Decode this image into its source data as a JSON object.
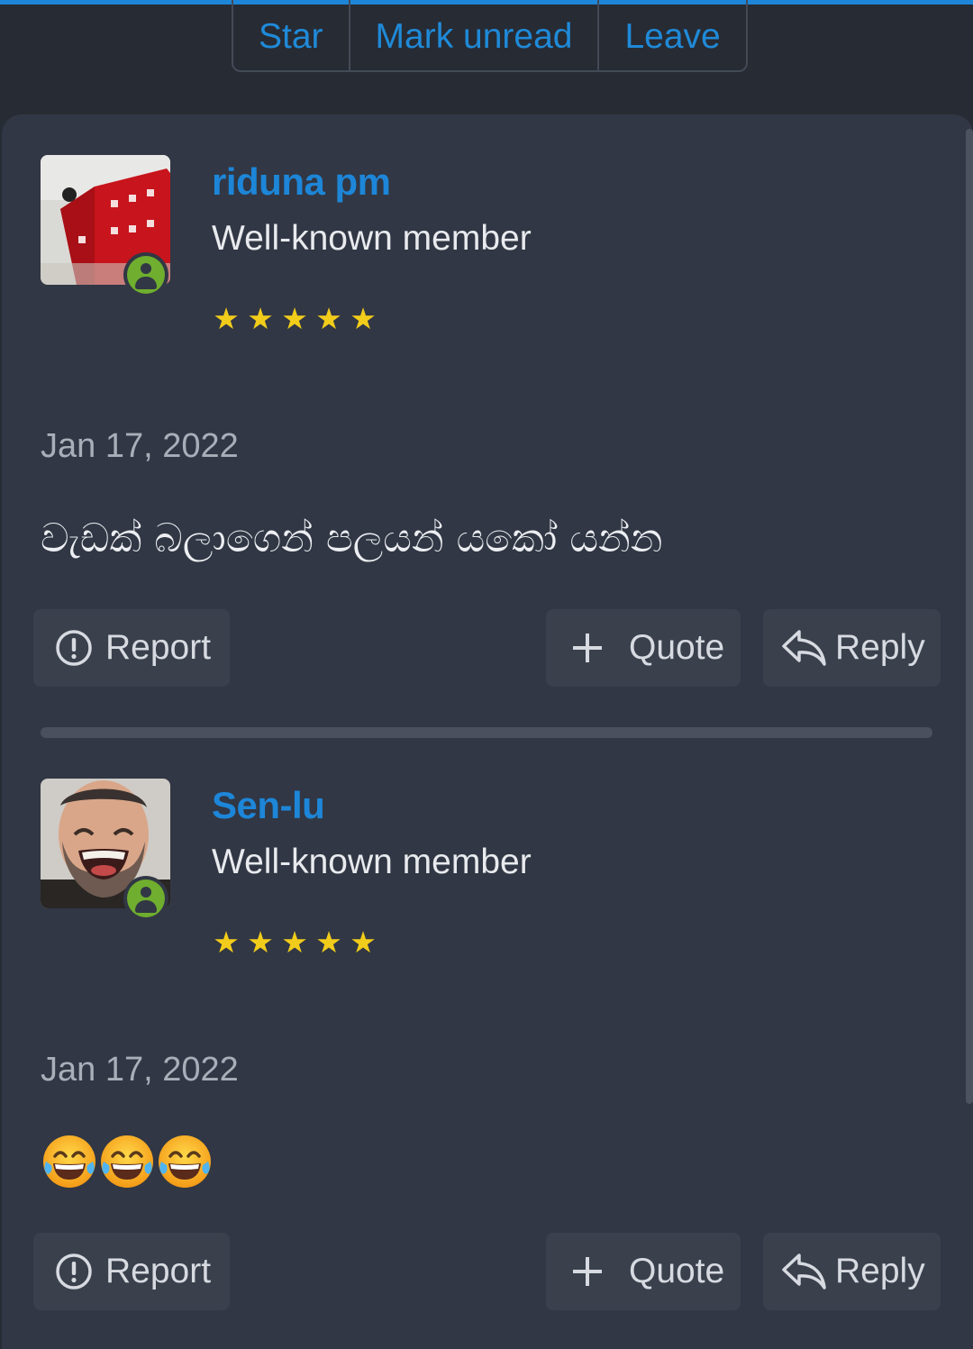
{
  "thread_actions": {
    "star": "Star",
    "mark_unread": "Mark unread",
    "leave": "Leave"
  },
  "colors": {
    "accent": "#1d86d8",
    "background": "#272b34",
    "panel": "#313744",
    "star": "#f2cc1b",
    "online": "#6fae2e"
  },
  "posts": [
    {
      "username": "riduna pm",
      "user_title": "Well-known member",
      "rating_stars": 5,
      "online": true,
      "avatar_icon": "red-building-avatar",
      "date": "Jan 17, 2022",
      "content": "වැඩක් බලාගෙන් පලයන් යකෝ යන්න",
      "actions": {
        "report": "Report",
        "quote": "Quote",
        "reply": "Reply"
      }
    },
    {
      "username": "Sen-lu",
      "user_title": "Well-known member",
      "rating_stars": 5,
      "online": true,
      "avatar_icon": "laughing-man-avatar",
      "date": "Jan 17, 2022",
      "content_emojis": [
        "😂",
        "😂",
        "😂"
      ],
      "actions": {
        "report": "Report",
        "quote": "Quote",
        "reply": "Reply"
      }
    }
  ]
}
